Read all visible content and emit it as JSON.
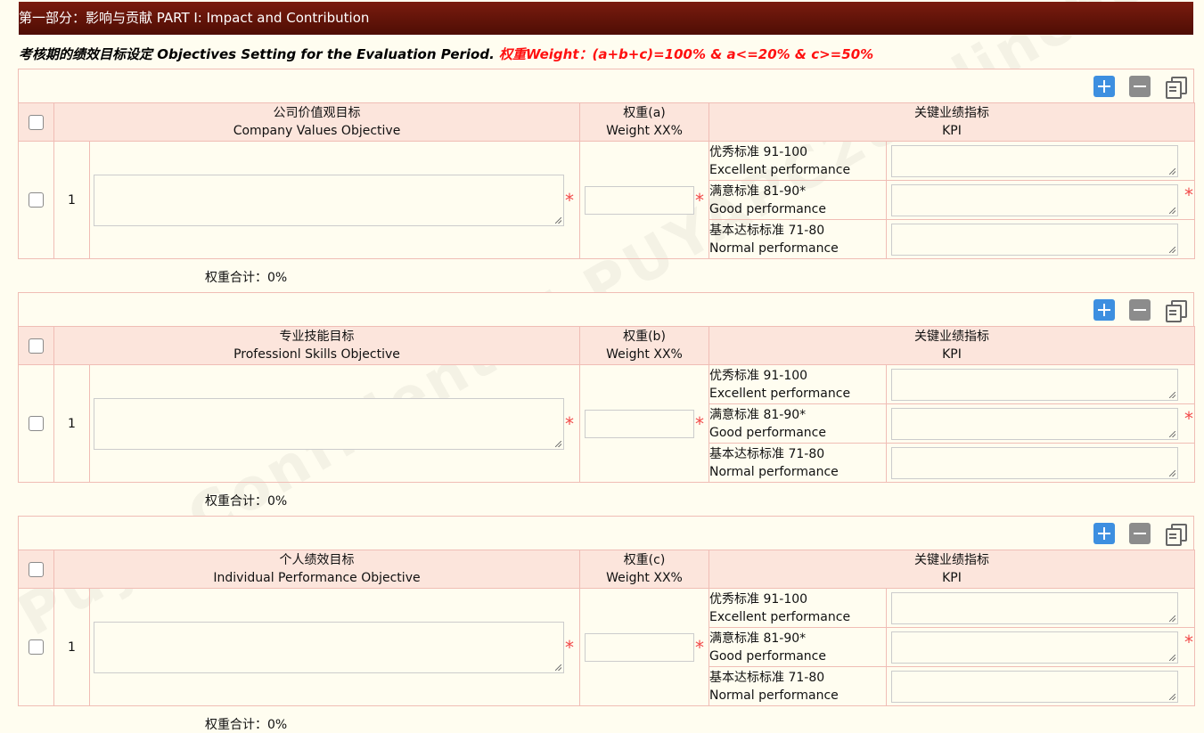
{
  "part_title": "第一部分：影响与贡献 PART I: Impact and Contribution",
  "intro_text": "考核期的绩效目标设定 Objectives Setting for the Evaluation Period.",
  "intro_weight": "权重Weight：(a+b+c)=100% & a<=20% & c>=50%",
  "watermark": "Puya Confidential PUYAPC288 linchenxi",
  "kpi_levels": [
    {
      "zh": "优秀标准 91-100",
      "en": "Excellent performance"
    },
    {
      "zh": "满意标准 81-90*",
      "en": "Good performance"
    },
    {
      "zh": "基本达标标准 71-80",
      "en": "Normal performance"
    }
  ],
  "sections": [
    {
      "objective_zh": "公司价值观目标",
      "objective_en": "Company Values Objective",
      "weight_zh": "权重(a)",
      "weight_en": "Weight XX%",
      "kpi_zh": "关键业绩指标",
      "kpi_en": "KPI",
      "row_number": "1",
      "total": "权重合计：0%"
    },
    {
      "objective_zh": "专业技能目标",
      "objective_en": "Professionl Skills Objective",
      "weight_zh": "权重(b)",
      "weight_en": "Weight XX%",
      "kpi_zh": "关键业绩指标",
      "kpi_en": "KPI",
      "row_number": "1",
      "total": "权重合计：0%"
    },
    {
      "objective_zh": "个人绩效目标",
      "objective_en": "Individual Performance Objective",
      "weight_zh": "权重(c)",
      "weight_en": "Weight XX%",
      "kpi_zh": "关键业绩指标",
      "kpi_en": "KPI",
      "row_number": "1",
      "total": "权重合计：0%"
    }
  ],
  "required_mark": "*",
  "icons": {
    "add": "plus-icon",
    "remove": "minus-icon",
    "copy": "copy-icon"
  },
  "colors": {
    "header_bar": "#5a1307",
    "accent_red": "#ff1010",
    "add_button": "#3d8fe0",
    "remove_button": "#8c8c8c",
    "table_border": "#f0bdb5",
    "table_header_bg": "#fce5dc"
  }
}
